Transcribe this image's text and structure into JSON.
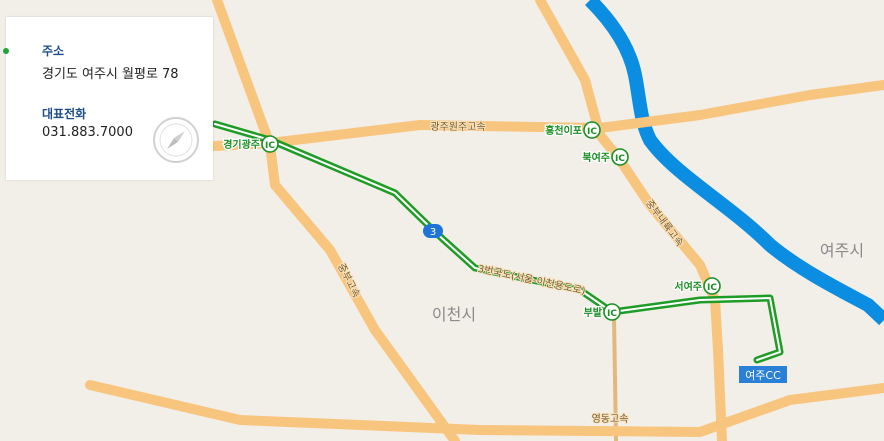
{
  "info_panel": {
    "address_label": "주소",
    "address_value": "경기도 여주시 월평로 78",
    "phone_label": "대표전화",
    "phone_value": "031.883.7000",
    "compass_icon": "compass-icon"
  },
  "map": {
    "colors": {
      "land": "#f2efe9",
      "highway": "#f8c57e",
      "route": "#22b22a",
      "river": "#0b8ee2",
      "local_road": "#e0b97f"
    },
    "place_labels": {
      "icheon": "이천시",
      "yeoju": "여주시"
    },
    "road_labels": {
      "gwangju_wonju": "광주원주고속",
      "yeongdong": "영동고속",
      "jungbu_north": "중부고속",
      "jungbu_naeryuk": "중부내륙고속",
      "national_3": "3번국도(서울-이천용도로)"
    },
    "ic_labels": {
      "gyeonggi_gwangju": "경기광주",
      "heungcheon_ipo": "흥천이포",
      "buk_yeoju": "북여주",
      "seo_yeoju": "서여주",
      "bubal": "부발"
    },
    "ic_symbol": "IC",
    "route_shield": "3",
    "destination": "여주CC"
  }
}
